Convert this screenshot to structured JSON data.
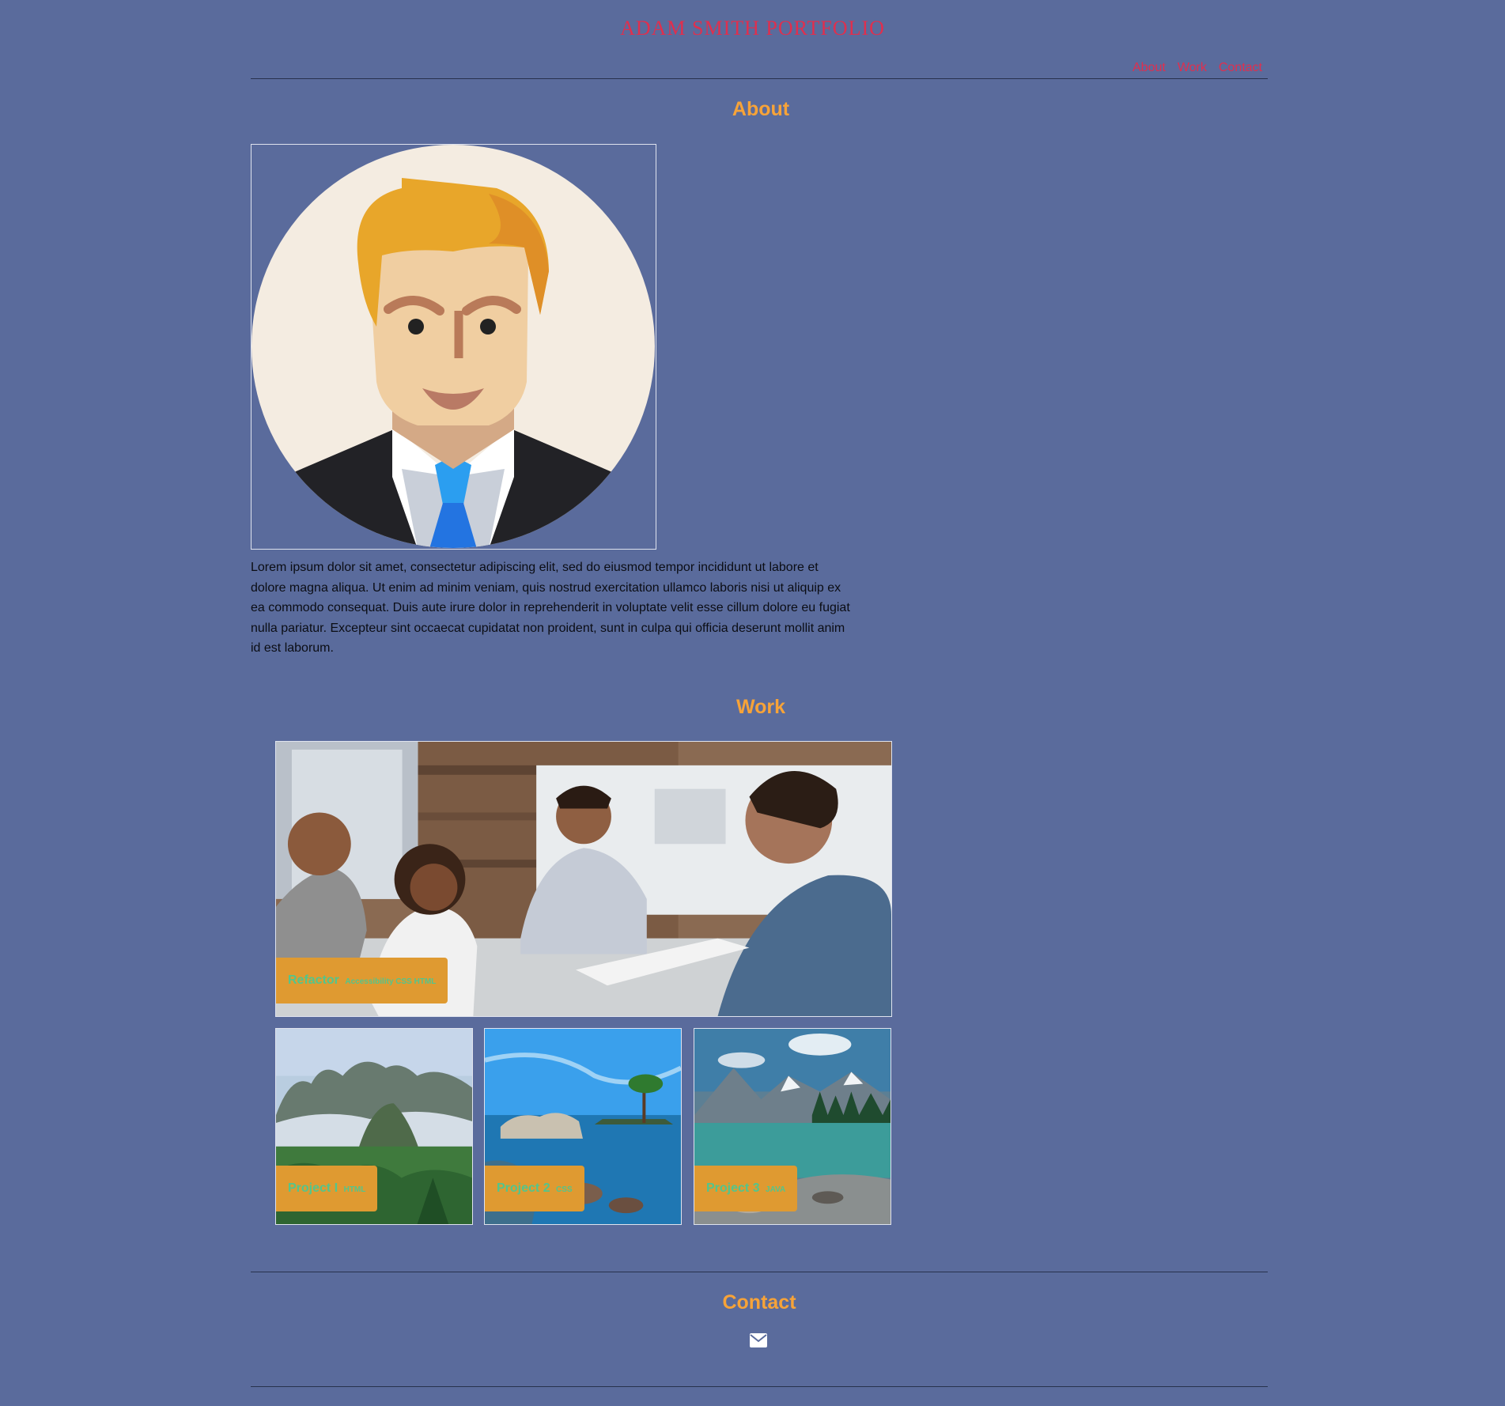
{
  "header": {
    "title": "ADAM SMITH PORTFOLIO"
  },
  "nav": {
    "items": [
      {
        "label": "About"
      },
      {
        "label": "Work"
      },
      {
        "label": "Contact"
      }
    ]
  },
  "about": {
    "heading": "About",
    "bio": "Lorem ipsum dolor sit amet, consectetur adipiscing elit, sed do eiusmod tempor incididunt ut labore et dolore magna aliqua. Ut enim ad minim veniam, quis nostrud exercitation ullamco laboris nisi ut aliquip ex ea commodo consequat. Duis aute irure dolor in reprehenderit in voluptate velit esse cillum dolore eu fugiat nulla pariatur. Excepteur sint occaecat cupidatat non proident, sunt in culpa qui officia deserunt mollit anim id est laborum."
  },
  "work": {
    "heading": "Work",
    "featured": {
      "title": "Refactor",
      "tech": "Accessibility CSS HTML"
    },
    "projects": [
      {
        "title": "Project I",
        "tech": "HTML"
      },
      {
        "title": "Project 2",
        "tech": "CSS"
      },
      {
        "title": "Project 3",
        "tech": "JAVA"
      }
    ]
  },
  "contact": {
    "heading": "Contact",
    "icon": "envelope-icon"
  },
  "colors": {
    "background": "#5a6b9c",
    "title_red": "#e02f4e",
    "heading_orange": "#f7a338",
    "label_bg": "#df9a31",
    "label_text": "#53c58c"
  }
}
